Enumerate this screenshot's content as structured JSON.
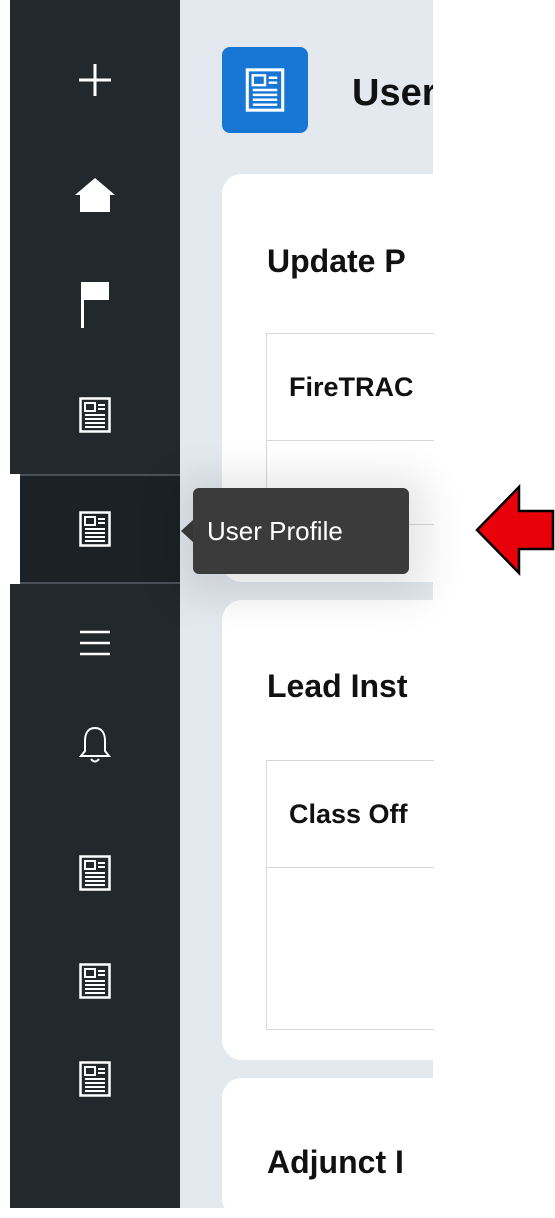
{
  "sidebar": {
    "items": [
      {
        "icon": "plus-icon"
      },
      {
        "icon": "home-icon"
      },
      {
        "icon": "flag-icon"
      },
      {
        "icon": "document-icon"
      },
      {
        "icon": "document-icon",
        "active": true
      },
      {
        "icon": "menu-icon"
      },
      {
        "icon": "bell-icon"
      },
      {
        "icon": "document-icon"
      },
      {
        "icon": "document-icon"
      },
      {
        "icon": "document-icon"
      }
    ]
  },
  "header": {
    "title": "User"
  },
  "cards": [
    {
      "title": "Update P",
      "table_header": "FireTRAC"
    },
    {
      "title": "Lead Inst",
      "table_header": "Class Off"
    },
    {
      "title": "Adjunct I"
    }
  ],
  "tooltip": {
    "text": "User Profile"
  },
  "colors": {
    "sidebar_bg": "#23282d",
    "accent": "#1877d4",
    "arrow": "#e8000b"
  }
}
